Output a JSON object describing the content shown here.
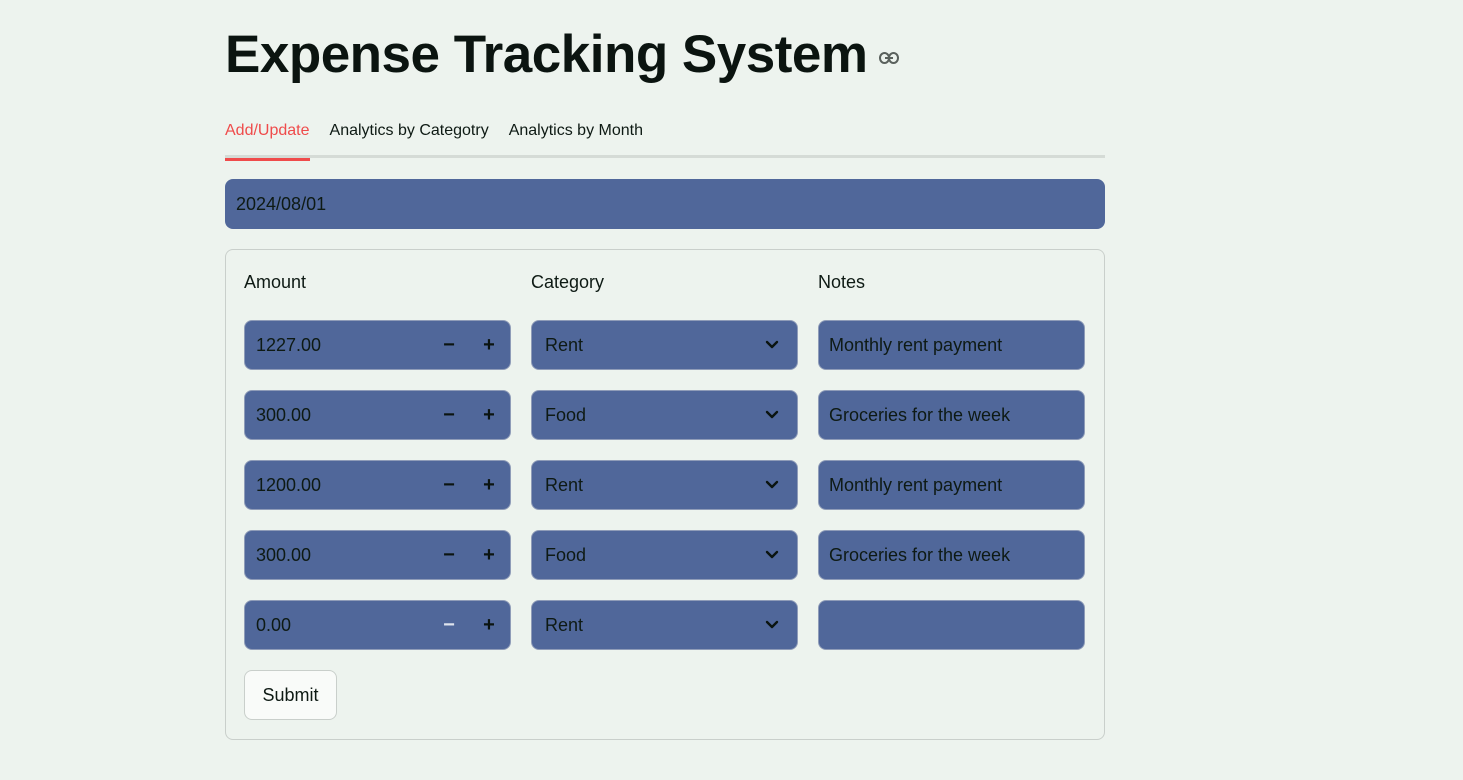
{
  "app": {
    "title": "Expense Tracking System"
  },
  "tabs": [
    {
      "label": "Add/Update",
      "active": true
    },
    {
      "label": "Analytics by Categotry",
      "active": false
    },
    {
      "label": "Analytics by Month",
      "active": false
    }
  ],
  "date_input": {
    "value": "2024/08/01"
  },
  "form": {
    "headers": {
      "amount": "Amount",
      "category": "Category",
      "notes": "Notes"
    },
    "rows": [
      {
        "amount": "1227.00",
        "category": "Rent",
        "notes": "Monthly rent payment"
      },
      {
        "amount": "300.00",
        "category": "Food",
        "notes": "Groceries for the week"
      },
      {
        "amount": "1200.00",
        "category": "Rent",
        "notes": "Monthly rent payment"
      },
      {
        "amount": "300.00",
        "category": "Food",
        "notes": "Groceries for the week"
      },
      {
        "amount": "0.00",
        "category": "Rent",
        "notes": ""
      }
    ],
    "stepper": {
      "minus": "−",
      "plus": "+"
    },
    "submit_label": "Submit"
  },
  "colors": {
    "background": "#edf3ee",
    "input_fill": "#50679a",
    "active_tab": "#ef4b4b"
  },
  "icons": {
    "title_link": "link-icon",
    "select_dropdown": "chevron-down-icon"
  }
}
